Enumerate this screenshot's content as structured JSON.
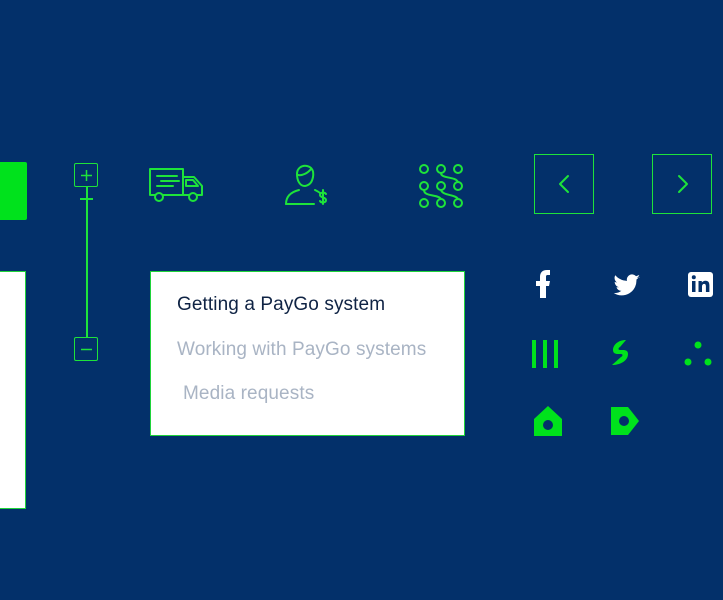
{
  "colors": {
    "background": "#03306a",
    "accent_green": "#1ee33a",
    "bright_green": "#00e21c",
    "card_bg": "#ffffff",
    "menu_active": "#0f2344",
    "menu_inactive": "#a9b4c4",
    "social_white": "#ffffff"
  },
  "zoom_slider": {
    "plus_icon": "plus-icon",
    "minus_icon": "minus-icon"
  },
  "icons": {
    "truck": "delivery-truck-icon",
    "person": "person-dollar-icon",
    "dots": "network-dots-icon"
  },
  "navigation": {
    "prev_icon": "chevron-left-icon",
    "next_icon": "chevron-right-icon"
  },
  "menu": {
    "items": [
      {
        "label": "Getting a PayGo system",
        "active": true
      },
      {
        "label": "Working with PayGo systems",
        "active": false
      },
      {
        "label": "Media requests",
        "active": false
      }
    ]
  },
  "social": {
    "facebook": "facebook-icon",
    "twitter": "twitter-icon",
    "linkedin": "linkedin-icon",
    "bars": "bars-logo-icon",
    "swirl": "swirl-logo-icon",
    "triangle_dots": "triangle-dots-icon",
    "home": "home-pin-icon",
    "tag": "tag-icon"
  }
}
